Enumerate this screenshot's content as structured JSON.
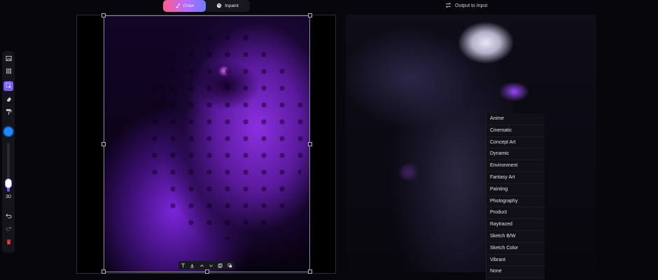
{
  "toolbar": {
    "draw_label": "Draw",
    "inpaint_label": "Inpaint",
    "output_to_input_label": "Output to Input"
  },
  "tools": {
    "brush_size": "30"
  },
  "colors": {
    "brush_color": "#1e88ff",
    "accent": "#7b5cff"
  },
  "icons": {
    "tool_rail": [
      "image-icon",
      "grid-icon",
      "select-icon",
      "eraser-icon",
      "paint-roller-icon",
      "undo-icon",
      "redo-icon",
      "trash-icon"
    ],
    "canvas_toolbar": [
      "text-icon",
      "download-icon",
      "chevron-up-icon",
      "chevron-down-icon",
      "copy-icon",
      "layers-icon"
    ]
  },
  "style_menu": {
    "items": [
      "Anime",
      "Cinematic",
      "Concept Art",
      "Dynamic",
      "Environment",
      "Fantasy Art",
      "Painting",
      "Photography",
      "Product",
      "Raytraced",
      "Sketch B/W",
      "Sketch Color",
      "Vibrant",
      "None"
    ]
  }
}
